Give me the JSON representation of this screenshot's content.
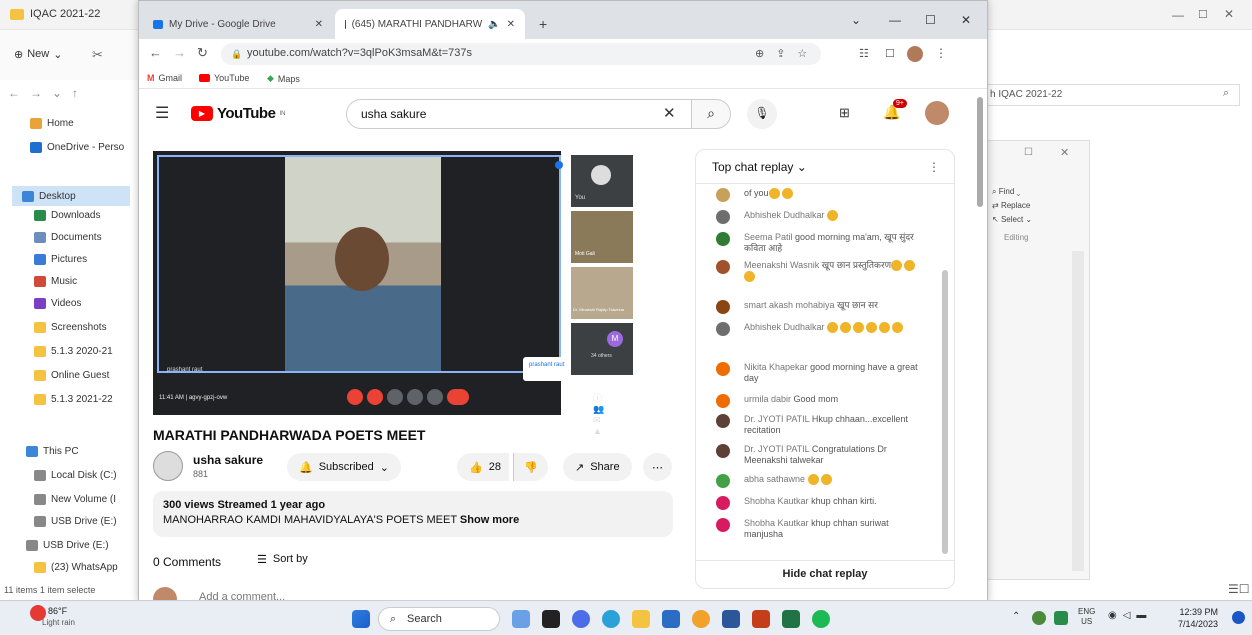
{
  "explorer": {
    "tab_title": "IQAC 2021-22",
    "new_label": "New",
    "search_placeholder": "h IQAC 2021-22",
    "sidebar": [
      {
        "label": "Home",
        "color": "#e9a33a"
      },
      {
        "label": "OneDrive - Perso",
        "color": "#1f6fd1"
      },
      {
        "label": "Desktop",
        "color": "#3b86d9"
      },
      {
        "label": "Downloads",
        "color": "#2a8c4a"
      },
      {
        "label": "Documents",
        "color": "#6c8ebf"
      },
      {
        "label": "Pictures",
        "color": "#3a7bd5"
      },
      {
        "label": "Music",
        "color": "#d04a3a"
      },
      {
        "label": "Videos",
        "color": "#7b3fc4"
      },
      {
        "label": "Screenshots",
        "color": "#f5c342"
      },
      {
        "label": "5.1.3 2020-21",
        "color": "#f5c342"
      },
      {
        "label": "Online Guest",
        "color": "#f5c342"
      },
      {
        "label": "5.1.3 2021-22",
        "color": "#f5c342"
      },
      {
        "label": "This PC",
        "color": "#3b86d9"
      },
      {
        "label": "Local Disk (C:)",
        "color": "#888"
      },
      {
        "label": "New Volume (I",
        "color": "#888"
      },
      {
        "label": "USB Drive (E:)",
        "color": "#888"
      },
      {
        "label": "USB Drive (E:)",
        "color": "#888"
      },
      {
        "label": "(23) WhatsApp",
        "color": "#f5c342"
      }
    ],
    "status": "11 items  1 item selecte",
    "word": {
      "find": "Find",
      "replace": "Replace",
      "select": "Select",
      "editing": "Editing"
    }
  },
  "chrome": {
    "tabs": [
      {
        "title": "My Drive - Google Drive",
        "icon_color": "#1a73e8"
      },
      {
        "title": "(645) MARATHI PANDHARW",
        "icon_color": "#ff0000"
      }
    ],
    "url": "youtube.com/watch?v=3qlPoK3msaM&t=737s",
    "bookmarks": [
      "Gmail",
      "YouTube",
      "Maps"
    ]
  },
  "youtube": {
    "logo_text": "YouTube",
    "logo_sup": "IN",
    "search_query": "usha sakure",
    "notif_count": "9+",
    "video": {
      "presenter": "prashant raut",
      "time": "11:41 AM",
      "meeting": "agvy-gpzj-ovw",
      "tiles": [
        "You",
        "Moti Gali",
        "Dr. Minakshi Rajdip Talwekar",
        "34 others"
      ],
      "pip_name": "prashant raut",
      "tile_letter": "M"
    },
    "title": "MARATHI PANDHARWADA POETS MEET",
    "channel": "usha sakure",
    "subs": "881",
    "subscribed_label": "Subscribed",
    "likes": "28",
    "share_label": "Share",
    "views": "300 views",
    "streamed": "Streamed 1 year ago",
    "description": "MANOHARRAO KAMDI MAHAVIDYALAYA'S POETS MEET",
    "show_more": "Show more",
    "comments_count": "0 Comments",
    "sort_by": "Sort by",
    "add_comment": "Add a comment..."
  },
  "chat": {
    "header": "Top chat replay",
    "hide_label": "Hide chat replay",
    "messages": [
      {
        "author": "",
        "text": "of you",
        "emoji": 2,
        "color": "#c7a15a"
      },
      {
        "author": "Abhishek Dudhalkar",
        "text": "",
        "emoji": 1,
        "color": "#6e6e6e"
      },
      {
        "author": "Seema Patil",
        "text": "good morning ma'am, खूप सुंदर कविता आहे",
        "emoji": 0,
        "color": "#2e7d32"
      },
      {
        "author": "Meenakshi Wasnik",
        "text": "खूप छान प्रस्तुतिकरण",
        "emoji": 3,
        "color": "#a0522d"
      },
      {
        "author": "smart akash mohabiya",
        "text": "खूप छान सर",
        "emoji": 0,
        "color": "#8b4513"
      },
      {
        "author": "Abhishek Dudhalkar",
        "text": "",
        "emoji": 6,
        "color": "#6e6e6e"
      },
      {
        "author": "Nikita Khapekar",
        "text": "good morning have a great day",
        "emoji": 0,
        "color": "#ef6c00"
      },
      {
        "author": "urmila dabir",
        "text": "Good mom",
        "emoji": 0,
        "color": "#ef6c00"
      },
      {
        "author": "Dr. JYOTI PATIL",
        "text": "Hkup chhaan...excellent recitation",
        "emoji": 0,
        "color": "#5d4037"
      },
      {
        "author": "Dr. JYOTI PATIL",
        "text": "Congratulations Dr Meenakshi talwekar",
        "emoji": 0,
        "color": "#5d4037"
      },
      {
        "author": "abha sathawne",
        "text": "",
        "emoji": 2,
        "color": "#43a047"
      },
      {
        "author": "Shobha Kautkar",
        "text": "khup chhan kirti.",
        "emoji": 0,
        "color": "#d81b60"
      },
      {
        "author": "Shobha Kautkar",
        "text": "khup chhan suriwat manjusha",
        "emoji": 0,
        "color": "#d81b60"
      }
    ]
  },
  "taskbar": {
    "weather_temp": "86°F",
    "weather_desc": "Light rain",
    "search_label": "Search",
    "lang": "ENG",
    "region": "US",
    "time": "12:39 PM",
    "date": "7/14/2023"
  }
}
